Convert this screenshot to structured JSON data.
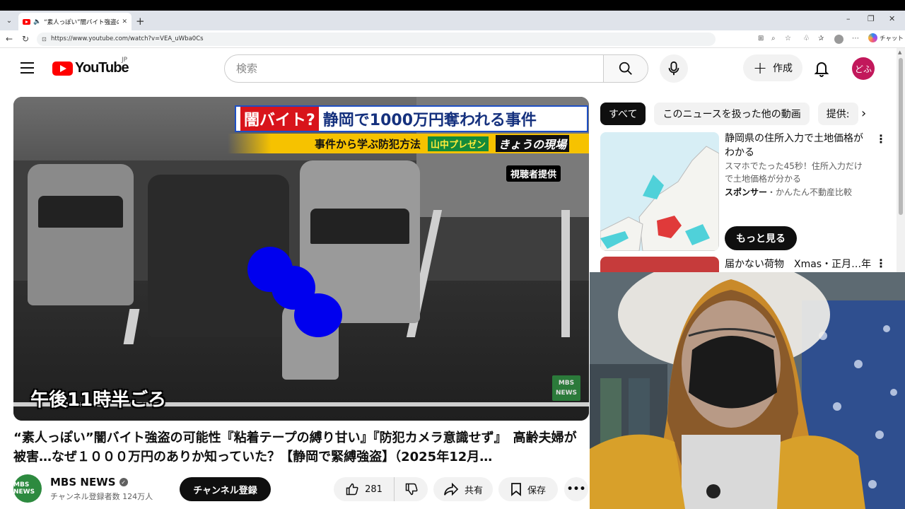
{
  "browser": {
    "tab_title": "“素人っぽい”闇バイト強盗の可能",
    "url": "https://www.youtube.com/watch?v=VEA_uWba0Cs",
    "copilot_label": "チャット"
  },
  "header": {
    "logo_text": "YouTube",
    "region": "JP",
    "search_placeholder": "検索",
    "create_label": "作成",
    "avatar_text": "どふ"
  },
  "player": {
    "banner_badge": "闇バイト?",
    "banner_main": "静岡で1000万円奪われる事件",
    "banner_sub": "事件から学ぶ防犯方法",
    "banner_tag": "山中プレゼン",
    "banner_tag2": "きょうの現場",
    "provided_label": "視聴者提供",
    "time_caption": "午後11時半ごろ",
    "watermark": "MBS NEWS"
  },
  "video": {
    "title": "“素人っぽい”闇バイト強盗の可能性『粘着テープの縛り甘い』『防犯カメラ意識せず』　高齢夫婦が被害…なぜ１０００万円のありか知っていた？【静岡で緊縛強盗】（2025年12月…",
    "channel_name": "MBS NEWS",
    "channel_avatar_text": "MBS NEWS",
    "subscribers": "チャンネル登録者数 124万人",
    "subscribe_label": "チャンネル登録",
    "like_count": "281",
    "share_label": "共有",
    "save_label": "保存"
  },
  "sidebar": {
    "chips": [
      "すべて",
      "このニュースを扱った他の動画",
      "提供:"
    ],
    "ad": {
      "title": "静岡県の住所入力で土地価格がわかる",
      "description": "スマホでたった45秒！住所入力だけで土地価格が分かる",
      "sponsor_label": "スポンサー",
      "sponsor_name": "・かんたん不動産比較",
      "more_label": "もっと見る"
    },
    "next_video_title": "届かない荷物　Xmas・正月…年"
  },
  "colors": {
    "brand_red": "#ff0000",
    "avatar_bg": "#c2185b",
    "mbs_green": "#2d8a3f"
  }
}
